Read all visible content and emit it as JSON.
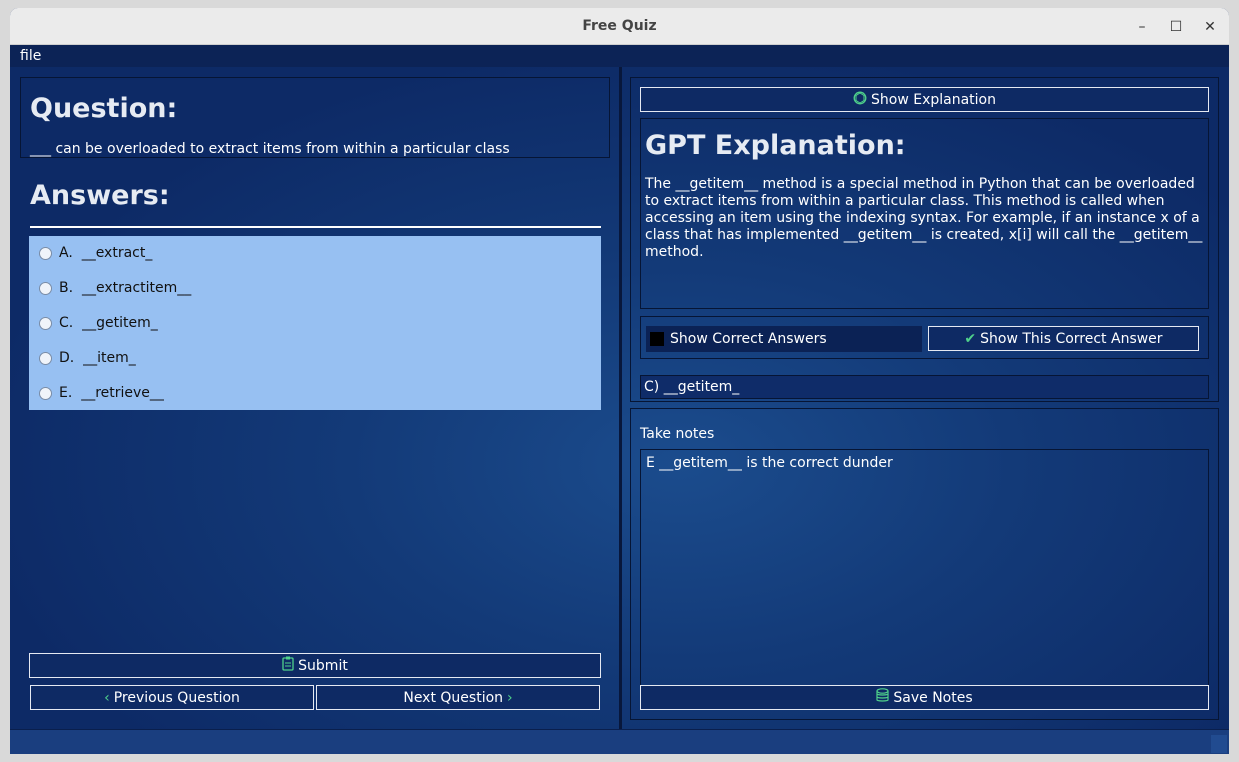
{
  "window": {
    "title": "Free Quiz",
    "minimize": "–",
    "maximize": "☐",
    "close": "✕"
  },
  "menu": {
    "file": "file"
  },
  "question": {
    "heading": "Question:",
    "text": "___ can be overloaded to extract items from within a particular class"
  },
  "answers": {
    "heading": "Answers:",
    "options": [
      {
        "letter": "A.",
        "text": "__extract_"
      },
      {
        "letter": "B.",
        "text": "__extractitem__"
      },
      {
        "letter": "C.",
        "text": "__getitem_"
      },
      {
        "letter": "D.",
        "text": "__item_"
      },
      {
        "letter": "E.",
        "text": "__retrieve__"
      }
    ]
  },
  "buttons": {
    "submit": "Submit",
    "previous": "Previous Question",
    "next": "Next Question",
    "show_explanation": "Show Explanation",
    "show_this_correct": "Show This Correct Answer",
    "save_notes": "Save Notes"
  },
  "explanation": {
    "heading": "GPT Explanation:",
    "text": "The __getitem__ method is a special method in Python that can be overloaded to extract items from within a particular class. This method is called when accessing an item using the indexing syntax. For example, if an instance x of a class that has implemented __getitem__ is created, x[i] will call the __getitem__ method."
  },
  "correct": {
    "checkbox_label": "Show Correct Answers",
    "checked": false,
    "answer": "C) __getitem_"
  },
  "notes": {
    "label": "Take notes",
    "text": "E __getitem__ is the correct dunder"
  },
  "colors": {
    "background": "#0d2a66",
    "answers_bg": "#97c0f2",
    "accent_icon": "#4fd18b"
  },
  "icons": {
    "explanation": "openai-icon",
    "submit": "clipboard-icon",
    "previous": "chevron-left-icon",
    "next": "chevron-right-icon",
    "check": "check-icon",
    "save": "database-icon"
  }
}
